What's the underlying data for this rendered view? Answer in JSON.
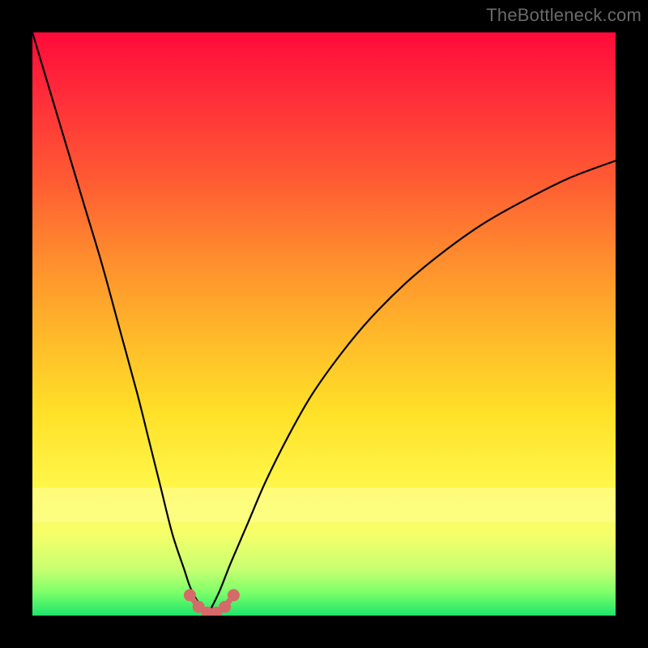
{
  "watermark": "TheBottleneck.com",
  "chart_data": {
    "type": "line",
    "title": "",
    "xlabel": "",
    "ylabel": "",
    "xlim": [
      0,
      100
    ],
    "ylim": [
      0,
      100
    ],
    "grid": false,
    "series": [
      {
        "name": "left-branch",
        "x": [
          0,
          3,
          6,
          9,
          12,
          15,
          18,
          20,
          22,
          24,
          26,
          27,
          28,
          29,
          30
        ],
        "y": [
          100,
          90,
          80,
          70,
          60,
          49,
          38,
          30,
          22,
          14,
          8,
          5,
          3,
          1.5,
          0
        ]
      },
      {
        "name": "right-branch",
        "x": [
          30,
          32,
          34,
          37,
          40,
          44,
          48,
          53,
          58,
          64,
          70,
          77,
          84,
          92,
          100
        ],
        "y": [
          0,
          4,
          9,
          16,
          23,
          31,
          38,
          45,
          51,
          57,
          62,
          67,
          71,
          75,
          78
        ]
      }
    ],
    "markers": {
      "name": "minimum-band",
      "x": [
        27,
        28.5,
        30,
        31.5,
        33,
        34.5
      ],
      "y": [
        3.5,
        1.5,
        0.5,
        0.5,
        1.5,
        3.5
      ]
    },
    "colors": {
      "gradient_top": "#ff0a3a",
      "gradient_bottom": "#1de56a",
      "curve": "#000000",
      "marker": "#d56a6a",
      "watermark": "#6a6a6a"
    }
  }
}
